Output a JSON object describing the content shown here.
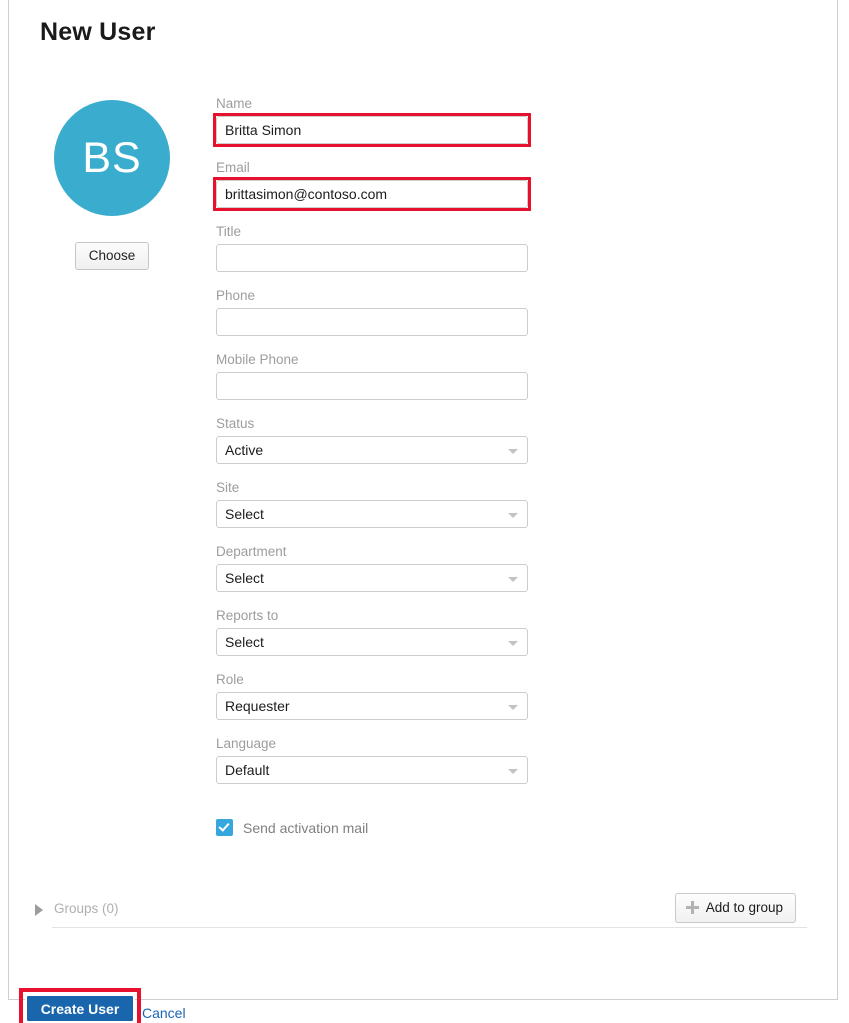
{
  "page": {
    "title": "New User"
  },
  "avatar": {
    "initials": "BS",
    "color": "#3aadcf",
    "choose_label": "Choose"
  },
  "form": {
    "fields": [
      {
        "label": "Name",
        "type": "text",
        "value": "Britta Simon",
        "placeholder": "",
        "highlighted": true
      },
      {
        "label": "Email",
        "type": "text",
        "value": "brittasimon@contoso.com",
        "placeholder": "",
        "highlighted": true
      },
      {
        "label": "Title",
        "type": "text",
        "value": "",
        "placeholder": "",
        "highlighted": false
      },
      {
        "label": "Phone",
        "type": "text",
        "value": "",
        "placeholder": "",
        "highlighted": false
      },
      {
        "label": "Mobile Phone",
        "type": "text",
        "value": "",
        "placeholder": "",
        "highlighted": false
      },
      {
        "label": "Status",
        "type": "select",
        "value": "Active",
        "highlighted": false
      },
      {
        "label": "Site",
        "type": "select",
        "value": "Select",
        "highlighted": false
      },
      {
        "label": "Department",
        "type": "select",
        "value": "Select",
        "highlighted": false
      },
      {
        "label": "Reports to",
        "type": "select",
        "value": "Select",
        "highlighted": false
      },
      {
        "label": "Role",
        "type": "select",
        "value": "Requester",
        "highlighted": false
      },
      {
        "label": "Language",
        "type": "select",
        "value": "Default",
        "highlighted": false
      }
    ]
  },
  "activation": {
    "label": "Send activation mail",
    "checked": true,
    "color": "#35a7de"
  },
  "groups": {
    "label": "Groups (0)",
    "expanded": false,
    "add_button_label": "Add to group",
    "add_button_icon": "plus-icon"
  },
  "footer": {
    "submit_label": "Create User",
    "submit_color": "#1966ad",
    "cancel_label": "Cancel",
    "cancel_color": "#1a66b5",
    "submit_highlighted": true
  },
  "annotation": {
    "color": "#e8112d"
  }
}
